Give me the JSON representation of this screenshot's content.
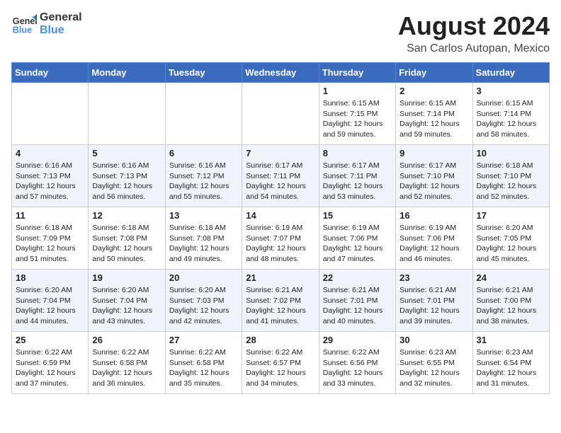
{
  "header": {
    "logo_line1": "General",
    "logo_line2": "Blue",
    "month_year": "August 2024",
    "location": "San Carlos Autopan, Mexico"
  },
  "weekdays": [
    "Sunday",
    "Monday",
    "Tuesday",
    "Wednesday",
    "Thursday",
    "Friday",
    "Saturday"
  ],
  "weeks": [
    [
      {
        "day": "",
        "info": ""
      },
      {
        "day": "",
        "info": ""
      },
      {
        "day": "",
        "info": ""
      },
      {
        "day": "",
        "info": ""
      },
      {
        "day": "1",
        "info": "Sunrise: 6:15 AM\nSunset: 7:15 PM\nDaylight: 12 hours\nand 59 minutes."
      },
      {
        "day": "2",
        "info": "Sunrise: 6:15 AM\nSunset: 7:14 PM\nDaylight: 12 hours\nand 59 minutes."
      },
      {
        "day": "3",
        "info": "Sunrise: 6:15 AM\nSunset: 7:14 PM\nDaylight: 12 hours\nand 58 minutes."
      }
    ],
    [
      {
        "day": "4",
        "info": "Sunrise: 6:16 AM\nSunset: 7:13 PM\nDaylight: 12 hours\nand 57 minutes."
      },
      {
        "day": "5",
        "info": "Sunrise: 6:16 AM\nSunset: 7:13 PM\nDaylight: 12 hours\nand 56 minutes."
      },
      {
        "day": "6",
        "info": "Sunrise: 6:16 AM\nSunset: 7:12 PM\nDaylight: 12 hours\nand 55 minutes."
      },
      {
        "day": "7",
        "info": "Sunrise: 6:17 AM\nSunset: 7:11 PM\nDaylight: 12 hours\nand 54 minutes."
      },
      {
        "day": "8",
        "info": "Sunrise: 6:17 AM\nSunset: 7:11 PM\nDaylight: 12 hours\nand 53 minutes."
      },
      {
        "day": "9",
        "info": "Sunrise: 6:17 AM\nSunset: 7:10 PM\nDaylight: 12 hours\nand 52 minutes."
      },
      {
        "day": "10",
        "info": "Sunrise: 6:18 AM\nSunset: 7:10 PM\nDaylight: 12 hours\nand 52 minutes."
      }
    ],
    [
      {
        "day": "11",
        "info": "Sunrise: 6:18 AM\nSunset: 7:09 PM\nDaylight: 12 hours\nand 51 minutes."
      },
      {
        "day": "12",
        "info": "Sunrise: 6:18 AM\nSunset: 7:08 PM\nDaylight: 12 hours\nand 50 minutes."
      },
      {
        "day": "13",
        "info": "Sunrise: 6:18 AM\nSunset: 7:08 PM\nDaylight: 12 hours\nand 49 minutes."
      },
      {
        "day": "14",
        "info": "Sunrise: 6:19 AM\nSunset: 7:07 PM\nDaylight: 12 hours\nand 48 minutes."
      },
      {
        "day": "15",
        "info": "Sunrise: 6:19 AM\nSunset: 7:06 PM\nDaylight: 12 hours\nand 47 minutes."
      },
      {
        "day": "16",
        "info": "Sunrise: 6:19 AM\nSunset: 7:06 PM\nDaylight: 12 hours\nand 46 minutes."
      },
      {
        "day": "17",
        "info": "Sunrise: 6:20 AM\nSunset: 7:05 PM\nDaylight: 12 hours\nand 45 minutes."
      }
    ],
    [
      {
        "day": "18",
        "info": "Sunrise: 6:20 AM\nSunset: 7:04 PM\nDaylight: 12 hours\nand 44 minutes."
      },
      {
        "day": "19",
        "info": "Sunrise: 6:20 AM\nSunset: 7:04 PM\nDaylight: 12 hours\nand 43 minutes."
      },
      {
        "day": "20",
        "info": "Sunrise: 6:20 AM\nSunset: 7:03 PM\nDaylight: 12 hours\nand 42 minutes."
      },
      {
        "day": "21",
        "info": "Sunrise: 6:21 AM\nSunset: 7:02 PM\nDaylight: 12 hours\nand 41 minutes."
      },
      {
        "day": "22",
        "info": "Sunrise: 6:21 AM\nSunset: 7:01 PM\nDaylight: 12 hours\nand 40 minutes."
      },
      {
        "day": "23",
        "info": "Sunrise: 6:21 AM\nSunset: 7:01 PM\nDaylight: 12 hours\nand 39 minutes."
      },
      {
        "day": "24",
        "info": "Sunrise: 6:21 AM\nSunset: 7:00 PM\nDaylight: 12 hours\nand 38 minutes."
      }
    ],
    [
      {
        "day": "25",
        "info": "Sunrise: 6:22 AM\nSunset: 6:59 PM\nDaylight: 12 hours\nand 37 minutes."
      },
      {
        "day": "26",
        "info": "Sunrise: 6:22 AM\nSunset: 6:58 PM\nDaylight: 12 hours\nand 36 minutes."
      },
      {
        "day": "27",
        "info": "Sunrise: 6:22 AM\nSunset: 6:58 PM\nDaylight: 12 hours\nand 35 minutes."
      },
      {
        "day": "28",
        "info": "Sunrise: 6:22 AM\nSunset: 6:57 PM\nDaylight: 12 hours\nand 34 minutes."
      },
      {
        "day": "29",
        "info": "Sunrise: 6:22 AM\nSunset: 6:56 PM\nDaylight: 12 hours\nand 33 minutes."
      },
      {
        "day": "30",
        "info": "Sunrise: 6:23 AM\nSunset: 6:55 PM\nDaylight: 12 hours\nand 32 minutes."
      },
      {
        "day": "31",
        "info": "Sunrise: 6:23 AM\nSunset: 6:54 PM\nDaylight: 12 hours\nand 31 minutes."
      }
    ]
  ]
}
